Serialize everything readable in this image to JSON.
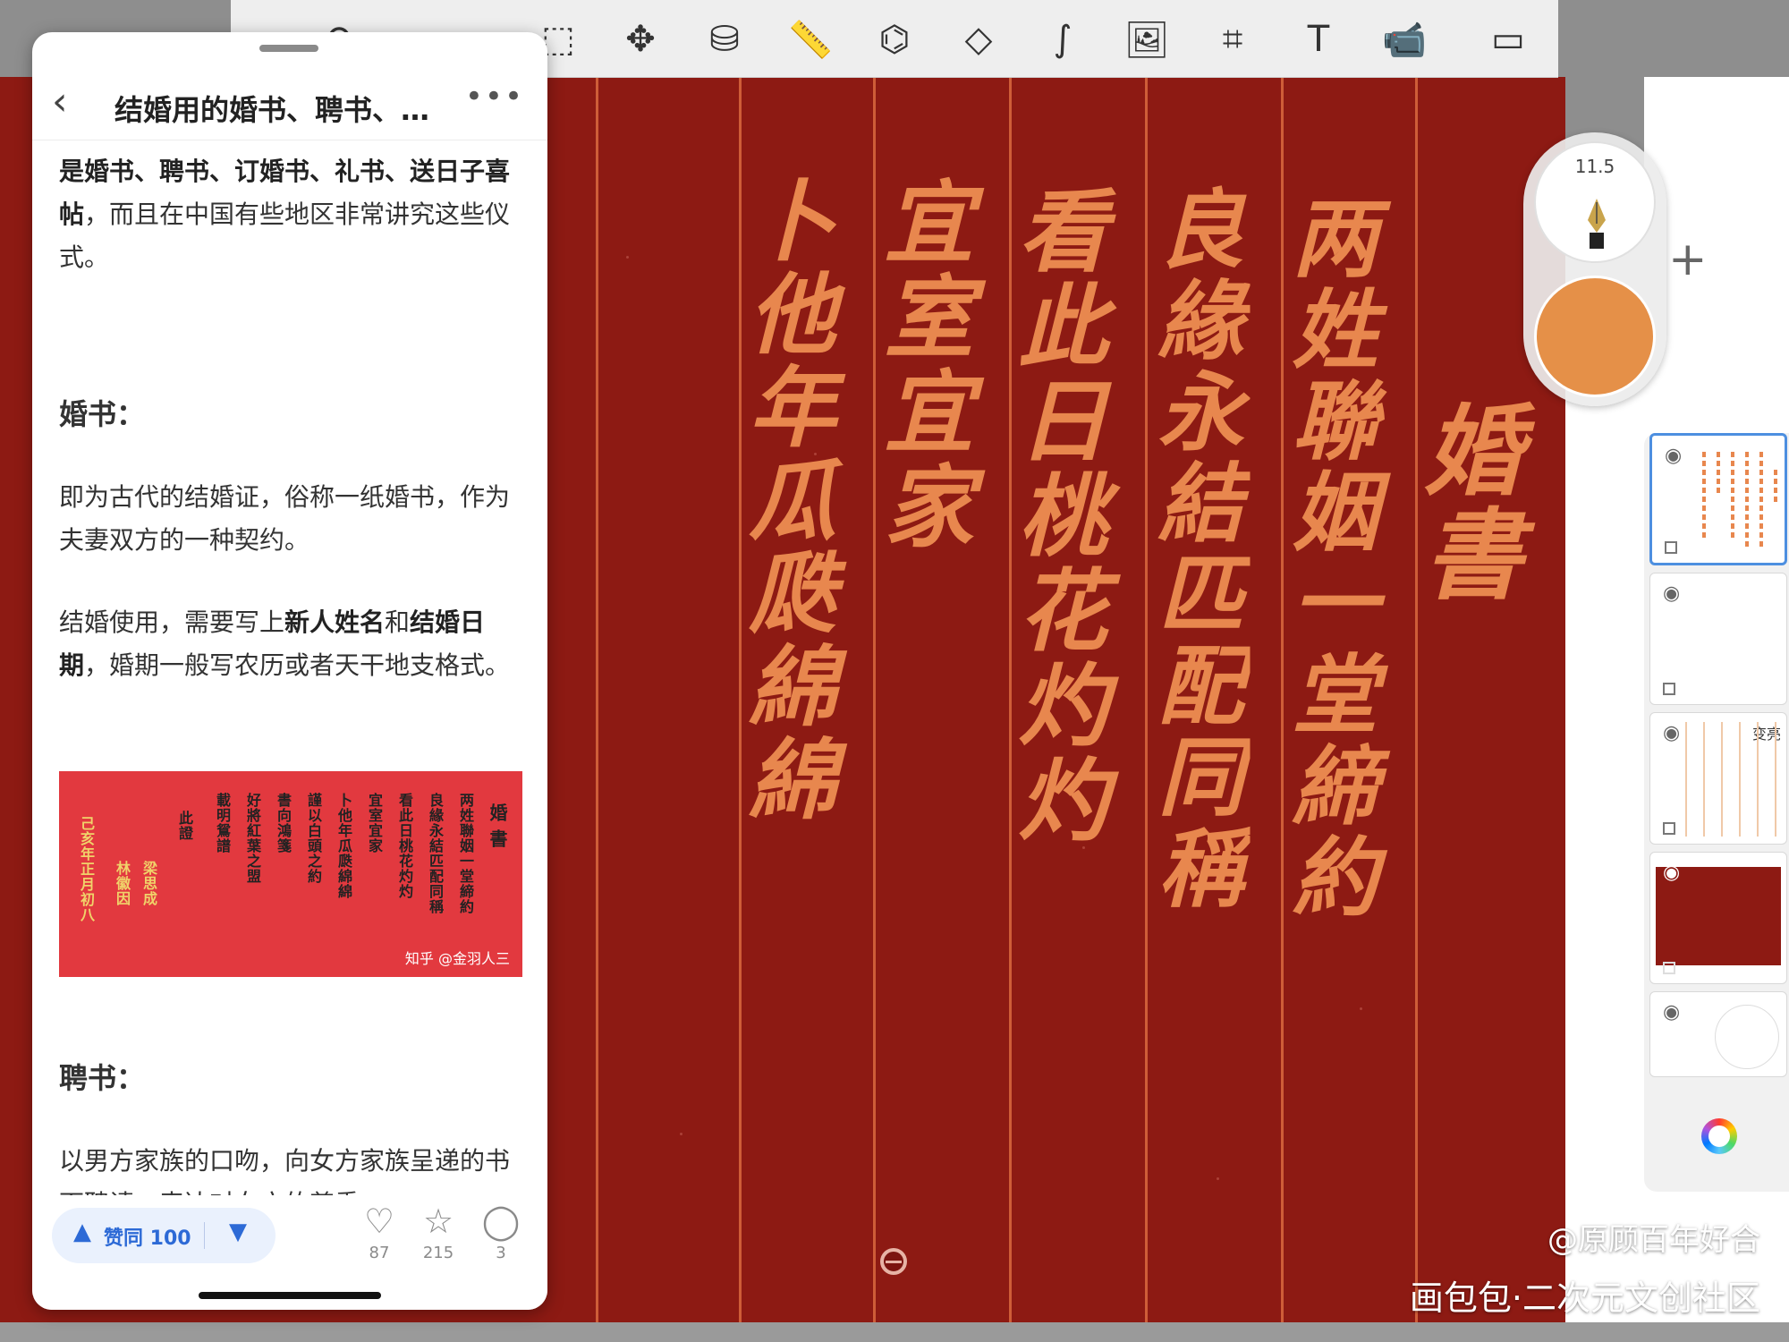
{
  "article": {
    "title": "结婚用的婚书、聘书、…",
    "intro_part1": "是婚书、聘书、订婚书、礼书、送日",
    "intro_bold": "子喜帖",
    "intro_part2": "，而且在中国有些地区非常讲究这些仪式。",
    "heading1": "婚书：",
    "para1": "即为古代的结婚证，俗称一纸婚书，作为夫妻双方的一种契约。",
    "para2_a": "结婚使用，需要写上",
    "para2_b": "新人姓名",
    "para2_c": "和",
    "para2_d": "结婚日期",
    "para2_e": "，婚期一般写农历或者天干地支格式。",
    "image_caption": "知乎 @金羽人三",
    "heading2": "聘书：",
    "para3": "以男方家族的口吻，向女方家族呈递的书面聘请，表达对女方的尊重。",
    "doc_columns": [
      "婚 書",
      "两姓聯姻一堂締約",
      "良緣永結匹配同稱",
      "看此日桃花灼灼",
      "宜室宜家",
      "卜他年瓜瓞綿綿",
      "謹以白頭之約",
      "書向鴻箋",
      "好將紅葉之盟",
      "載明鴛譜",
      "此證",
      "梁思成",
      "林徽因",
      "己亥年正月初八"
    ]
  },
  "footer": {
    "vote_label": "赞同 100",
    "likes": "87",
    "stars": "215",
    "comments": "3"
  },
  "canvas": {
    "columns": [
      "婚書",
      "两姓聯姻一堂締約",
      "良緣永結匹配同稱",
      "看此日桃花灼灼",
      "宜室宜家",
      "卜他年瓜瓞綿綿"
    ]
  },
  "brush": {
    "size": "11.5",
    "color": "#e59048"
  },
  "layers": {
    "blend_mode": "变亮"
  },
  "watermark": {
    "line1": "@原顾百年好合",
    "line2": "画包包·二次元文创社区"
  },
  "colors": {
    "canvas_bg": "#8d1a13",
    "ink": "#e8874e",
    "accent": "#2d6ad6"
  }
}
